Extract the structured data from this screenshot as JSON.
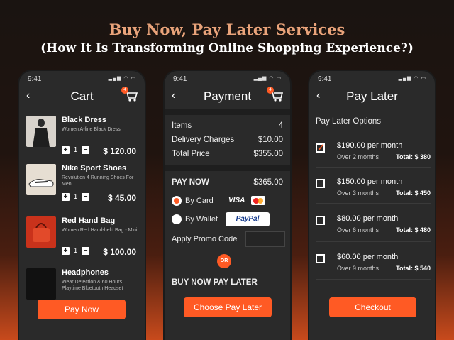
{
  "headline": {
    "line1": "Buy Now, Pay Later Services",
    "line2": "(How It Is Transforming Online Shopping Experience?)"
  },
  "status_time": "9:41",
  "cart_badge": "4",
  "cart": {
    "title": "Cart",
    "items": [
      {
        "name": "Black Dress",
        "desc": "Women A-line Black Dress",
        "qty": "1",
        "price": "$ 120.00",
        "thumb_color": "#2b2b2b"
      },
      {
        "name": "Nike Sport Shoes",
        "desc": "Revolution 4 Running Shoes For Men",
        "qty": "1",
        "price": "$ 45.00",
        "thumb_color": "#e6ded2"
      },
      {
        "name": "Red Hand Bag",
        "desc": "Women Red Hand-held Bag - Mini",
        "qty": "1",
        "price": "$ 100.00",
        "thumb_color": "#c9321b"
      },
      {
        "name": "Headphones",
        "desc": "Wear Detection & 60 Hours Playtime Bluetooth Headset",
        "qty": "",
        "price": "",
        "thumb_color": "#111111"
      }
    ],
    "button": "Pay Now"
  },
  "payment": {
    "title": "Payment",
    "items_label": "Items",
    "items_value": "4",
    "delivery_label": "Delivery Charges",
    "delivery_value": "$10.00",
    "total_label": "Total Price",
    "total_value": "$355.00",
    "pay_now_label": "PAY NOW",
    "pay_now_value": "$365.00",
    "by_card": "By Card",
    "visa": "VISA",
    "by_wallet": "By Wallet",
    "paypal": "PayPal",
    "promo_label": "Apply Promo Code",
    "or_label": "OR",
    "bnpl_label": "BUY NOW PAY LATER",
    "button": "Choose Pay Later"
  },
  "paylater": {
    "title": "Pay Later",
    "options_label": "Pay Later Options",
    "options": [
      {
        "amount": "$190.00 per month",
        "term": "Over 2 months",
        "total": "Total: $ 380",
        "checked": true
      },
      {
        "amount": "$150.00 per month",
        "term": "Over 3 months",
        "total": "Total: $ 450",
        "checked": false
      },
      {
        "amount": "$80.00 per month",
        "term": "Over 6 months",
        "total": "Total: $ 480",
        "checked": false
      },
      {
        "amount": "$60.00 per month",
        "term": "Over 9 months",
        "total": "Total: $ 540",
        "checked": false
      }
    ],
    "button": "Checkout"
  },
  "colors": {
    "accent": "#ff5a24",
    "panel": "#2a2a2a",
    "headline": "#e9a37a"
  }
}
